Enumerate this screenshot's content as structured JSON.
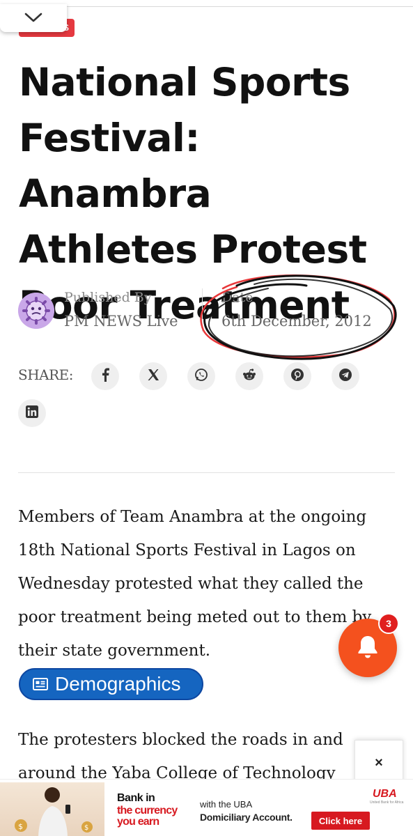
{
  "article": {
    "category": "S",
    "title": "National Sports Festival: Anambra Athletes Protest Poor Treatment",
    "published_by_label": "Published By",
    "author": "PM NEWS Live",
    "date_label": "Date",
    "date": "6th December, 2012",
    "share_label": "SHARE:",
    "share_buttons": [
      "facebook-icon",
      "x-icon",
      "whatsapp-icon",
      "reddit-icon",
      "pinterest-icon",
      "telegram-icon",
      "linkedin-icon"
    ],
    "paragraph1": "Members of Team Anambra at the ongoing 18th National Sports Festival in Lagos on Wednesday protested what they called the poor treatment being meted out to them by their state government.",
    "tag_chip": "Demographics",
    "paragraph2": "The protesters blocked the roads in and around the Yaba College of Technology"
  },
  "notifications": {
    "count": "3"
  },
  "ad": {
    "close_label": "×",
    "headline_line1": "Bank in",
    "headline_line2": "the currency",
    "headline_line3": "you earn",
    "middle_line1": "with the UBA",
    "middle_line2": "Domiciliary Account.",
    "brand": "UBA",
    "brand_sub": "United Bank for Africa",
    "cta": "Click here"
  },
  "colors": {
    "accent_red": "#e53940",
    "notif_orange": "#f4511e",
    "chip_blue": "#1565c0",
    "uba_red": "#d71920"
  }
}
